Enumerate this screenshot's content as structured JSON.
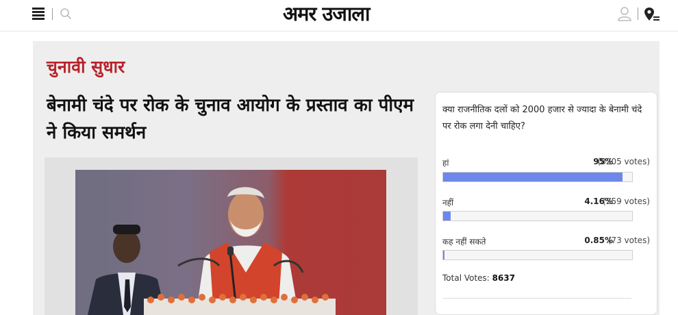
{
  "header": {
    "logo": "अमर उजाला",
    "icons": [
      "menu-icon",
      "search-icon",
      "user-icon",
      "location-icon"
    ]
  },
  "article": {
    "category": "चुनावी सुधार",
    "headline": "बेनामी चंदे पर रोक के चुनाव आयोग के प्रस्ताव का पीएम ने किया समर्थन"
  },
  "poll": {
    "question": "क्या राजनीतिक दलों को 2000 हजार से ज्यादा के बेनामी चंदे पर रोक लगा देनी चाहिए?",
    "options": [
      {
        "label": "हां",
        "percent": "95%",
        "votes": "(8205 votes)",
        "fraction": 0.95
      },
      {
        "label": "नहीं",
        "percent": "4.16%",
        "votes": "(359 votes)",
        "fraction": 0.0416
      },
      {
        "label": "कह नहीं सकते",
        "percent": "0.85%",
        "votes": "(73 votes)",
        "fraction": 0.0085
      }
    ],
    "total_label": "Total Votes:",
    "total_value": "8637",
    "bar_color": "#6d87ea"
  },
  "colors": {
    "category": "#b8222a",
    "panel_background": "#eeeeee"
  }
}
